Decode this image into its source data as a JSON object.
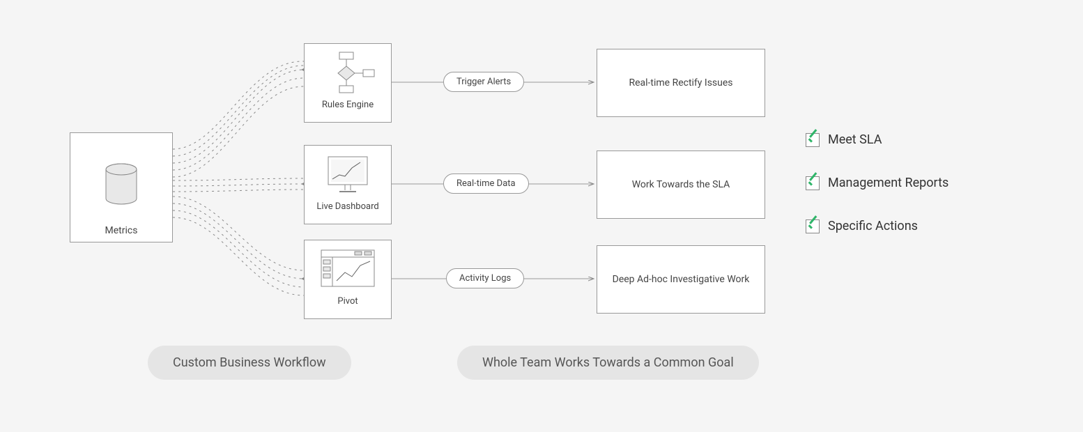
{
  "source": {
    "label": "Metrics"
  },
  "nodes": [
    {
      "id": "rules",
      "label": "Rules Engine"
    },
    {
      "id": "dashboard",
      "label": "Live Dashboard"
    },
    {
      "id": "pivot",
      "label": "Pivot"
    }
  ],
  "pills": [
    {
      "id": "alerts",
      "label": "Trigger Alerts"
    },
    {
      "id": "realtime",
      "label": "Real-time Data"
    },
    {
      "id": "logs",
      "label": "Activity Logs"
    }
  ],
  "outcomes": [
    {
      "id": "rectify",
      "label": "Real-time Rectify Issues"
    },
    {
      "id": "sla",
      "label": "Work Towards the SLA"
    },
    {
      "id": "adhoc",
      "label": "Deep Ad-hoc Investigative Work"
    }
  ],
  "captions": {
    "left": "Custom Business Workflow",
    "right": "Whole Team Works Towards a Common Goal"
  },
  "checks": [
    {
      "label": "Meet SLA"
    },
    {
      "label": "Management Reports"
    },
    {
      "label": "Specific Actions"
    }
  ],
  "colors": {
    "accent": "#2fb569",
    "border": "#999999",
    "text": "#444444",
    "bg": "#f5f5f5",
    "captionBg": "#e5e5e5"
  }
}
